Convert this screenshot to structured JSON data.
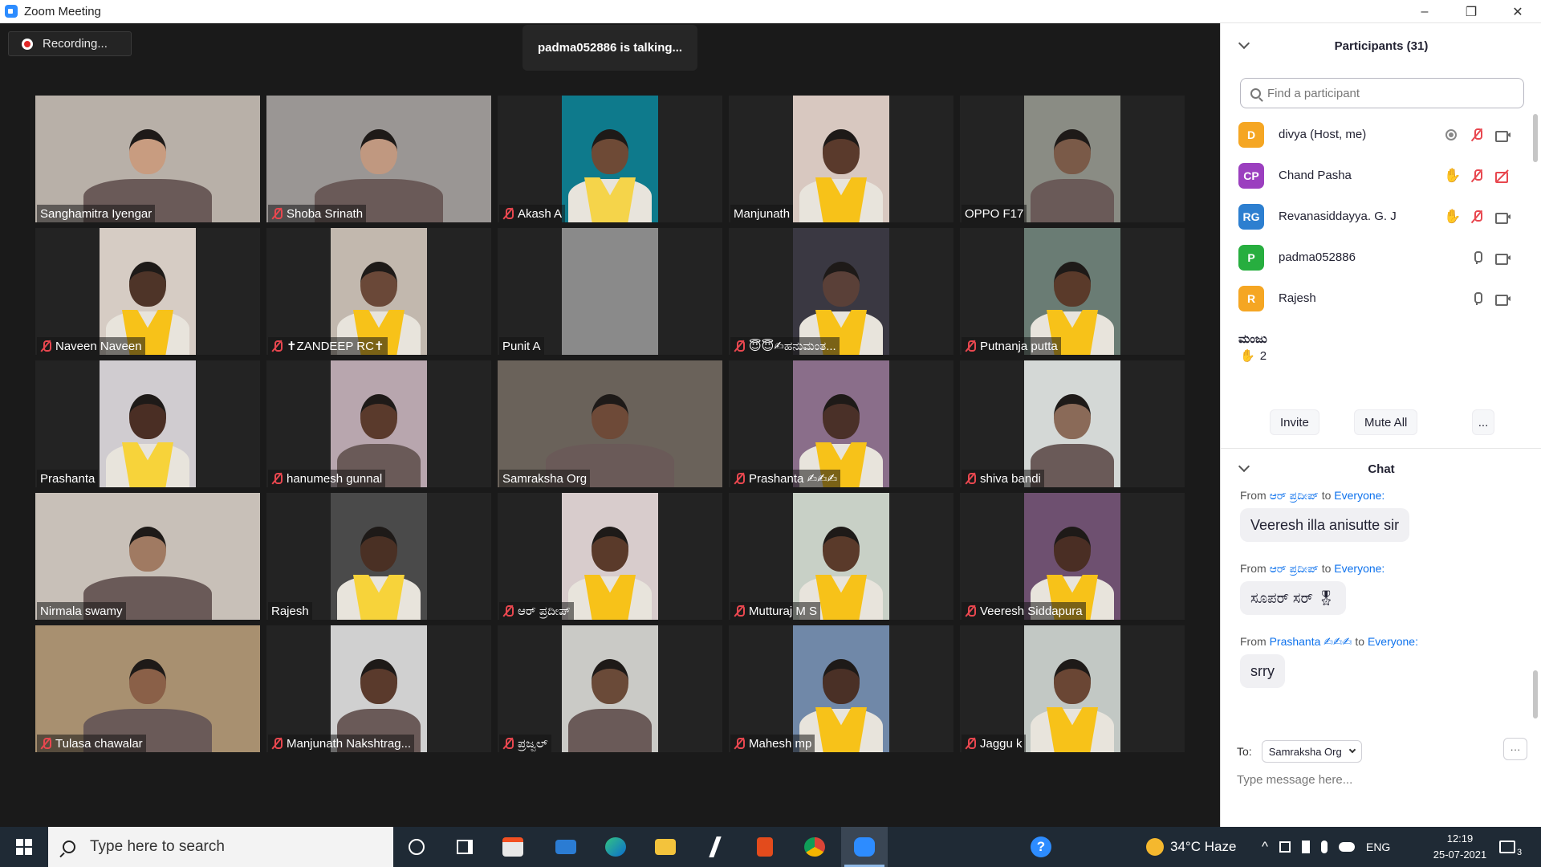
{
  "window": {
    "title": "Zoom Meeting",
    "minimize": "–",
    "maximize": "❐",
    "close": "✕"
  },
  "meeting": {
    "recording_label": "Recording...",
    "talking_banner": "padma052886 is talking..."
  },
  "tiles": [
    {
      "name": "Sanghamitra Iyengar",
      "muted": false
    },
    {
      "name": "Shoba Srinath",
      "muted": true
    },
    {
      "name": "Akash A",
      "muted": true
    },
    {
      "name": "Manjunath",
      "muted": false
    },
    {
      "name": "OPPO F17",
      "muted": false
    },
    {
      "name": "Naveen Naveen",
      "muted": true
    },
    {
      "name": "✝ZANDEEP RC✝",
      "muted": true
    },
    {
      "name": "Punit A",
      "muted": false
    },
    {
      "name": "😇😇✍ಹನುಮಂತ...",
      "muted": true
    },
    {
      "name": "Putnanja putta",
      "muted": true
    },
    {
      "name": "Prashanta",
      "muted": false
    },
    {
      "name": "hanumesh gunnal",
      "muted": true
    },
    {
      "name": "Samraksha Org",
      "muted": false
    },
    {
      "name": "Prashanta ✍✍✍",
      "muted": true
    },
    {
      "name": "shiva bandi",
      "muted": true
    },
    {
      "name": "Nirmala swamy",
      "muted": false
    },
    {
      "name": "Rajesh",
      "muted": false
    },
    {
      "name": "ಆರ್ ಪ್ರದೀಪ್",
      "muted": true
    },
    {
      "name": "Mutturaj M S",
      "muted": true
    },
    {
      "name": "Veeresh Siddapura",
      "muted": true
    },
    {
      "name": "Tulasa chawalar",
      "muted": true
    },
    {
      "name": "Manjunath Nakshtrag...",
      "muted": true
    },
    {
      "name": "ಪ್ರಜ್ವಲ್",
      "muted": true
    },
    {
      "name": "Mahesh mp",
      "muted": true
    },
    {
      "name": "Jaggu k",
      "muted": true
    }
  ],
  "participants": {
    "title": "Participants (31)",
    "search_placeholder": "Find a participant",
    "list": [
      {
        "initials": "D",
        "name": "divya (Host, me)",
        "color": "#f5a623",
        "icons": [
          "record-icon",
          "mic-off-icon",
          "video-icon"
        ]
      },
      {
        "initials": "CP",
        "name": "Chand Pasha",
        "color": "#9b3fbf",
        "icons": [
          "hand-icon",
          "mic-off-icon",
          "video-off-icon"
        ]
      },
      {
        "initials": "RG",
        "name": "Revanasiddayya. G. J",
        "color": "#2d7fd0",
        "icons": [
          "hand-icon",
          "mic-off-icon",
          "video-icon"
        ]
      },
      {
        "initials": "P",
        "name": "padma052886",
        "color": "#27ae3f",
        "icons": [
          "mic-icon",
          "video-icon"
        ]
      },
      {
        "initials": "R",
        "name": "Rajesh",
        "color": "#f5a623",
        "icons": [
          "mic-icon",
          "video-icon"
        ]
      },
      {
        "initials": "",
        "name": "ಮಂಜು",
        "color": "#ffffff",
        "icons": []
      }
    ],
    "raised_hands": "2",
    "invite_label": "Invite",
    "mute_all_label": "Mute All",
    "more_label": "..."
  },
  "chat": {
    "title": "Chat",
    "messages": [
      {
        "from_prefix": "From",
        "from": "ಆರ್ ಪ್ರದೀಪ್",
        "to_word": "to",
        "to": "Everyone:",
        "text": "Veeresh illa anisutte sir"
      },
      {
        "from_prefix": "From",
        "from": "ಆರ್ ಪ್ರದೀಪ್",
        "to_word": "to",
        "to": "Everyone:",
        "text": "ಸೂಪರ್ ಸರ್ 🎖"
      },
      {
        "from_prefix": "From",
        "from": "Prashanta",
        "decoration": "✍✍✍",
        "to_word": "to",
        "to": "Everyone:",
        "text": "srry"
      }
    ],
    "to_label": "To:",
    "to_value": "Samraksha Org",
    "more": "···",
    "input_placeholder": "Type message here..."
  },
  "taskbar": {
    "search_placeholder": "Type here to search",
    "weather": "34°C  Haze",
    "language": "ENG",
    "time": "12:19",
    "date": "25-07-2021",
    "notifications": "3"
  }
}
